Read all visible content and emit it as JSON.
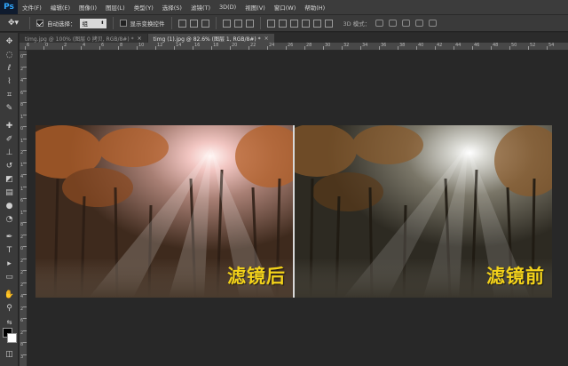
{
  "app": {
    "logo": "Ps"
  },
  "menu": [
    "文件(F)",
    "编辑(E)",
    "图像(I)",
    "图层(L)",
    "类型(Y)",
    "选择(S)",
    "滤镜(T)",
    "3D(D)",
    "视图(V)",
    "窗口(W)",
    "帮助(H)"
  ],
  "options": {
    "auto_select_label": "自动选择：",
    "auto_select_checked": true,
    "group_value": "组",
    "show_transform_label": "显示变换控件",
    "show_transform_checked": false,
    "mode_3d_label": "3D 模式："
  },
  "tabs": [
    {
      "label": "timg.jpg @ 100% (图层 0 拷贝, RGB/8#) *",
      "close": "×",
      "active": false
    },
    {
      "label": "timg (1).jpg @ 82.6% (图层 1, RGB/8#) *",
      "close": "×",
      "active": true
    }
  ],
  "ruler_top_ticks": [
    "6",
    "0",
    "2",
    "4",
    "6",
    "8",
    "10",
    "12",
    "14",
    "16",
    "18",
    "20",
    "22",
    "24",
    "26",
    "28",
    "30",
    "32",
    "34",
    "36",
    "38",
    "40",
    "42",
    "44",
    "46",
    "48",
    "50",
    "52",
    "54"
  ],
  "ruler_left_ticks": [
    "0",
    "2",
    "4",
    "6",
    "8",
    "1",
    "0",
    "1",
    "2",
    "1",
    "4",
    "1",
    "6",
    "1",
    "8",
    "2",
    "0",
    "2",
    "2",
    "2",
    "4",
    "2",
    "6",
    "2",
    "8",
    "3"
  ],
  "toolbar_icons": [
    "move-tool-icon",
    "marquee-tool-icon",
    "lasso-tool-icon",
    "quick-select-tool-icon",
    "crop-tool-icon",
    "eyedropper-tool-icon",
    "healing-brush-tool-icon",
    "brush-tool-icon",
    "clone-stamp-tool-icon",
    "history-brush-tool-icon",
    "eraser-tool-icon",
    "gradient-tool-icon",
    "blur-tool-icon",
    "dodge-tool-icon",
    "pen-tool-icon",
    "type-tool-icon",
    "path-select-tool-icon",
    "shape-tool-icon",
    "hand-tool-icon",
    "zoom-tool-icon",
    "swap-colors-icon",
    "foreground-background-colors-icon",
    "quick-mask-icon"
  ],
  "images": {
    "left_caption": "滤镜后",
    "right_caption": "滤镜前"
  },
  "colors": {
    "caption": "#f3d21a",
    "ps_logo_text": "#31a8ff"
  }
}
